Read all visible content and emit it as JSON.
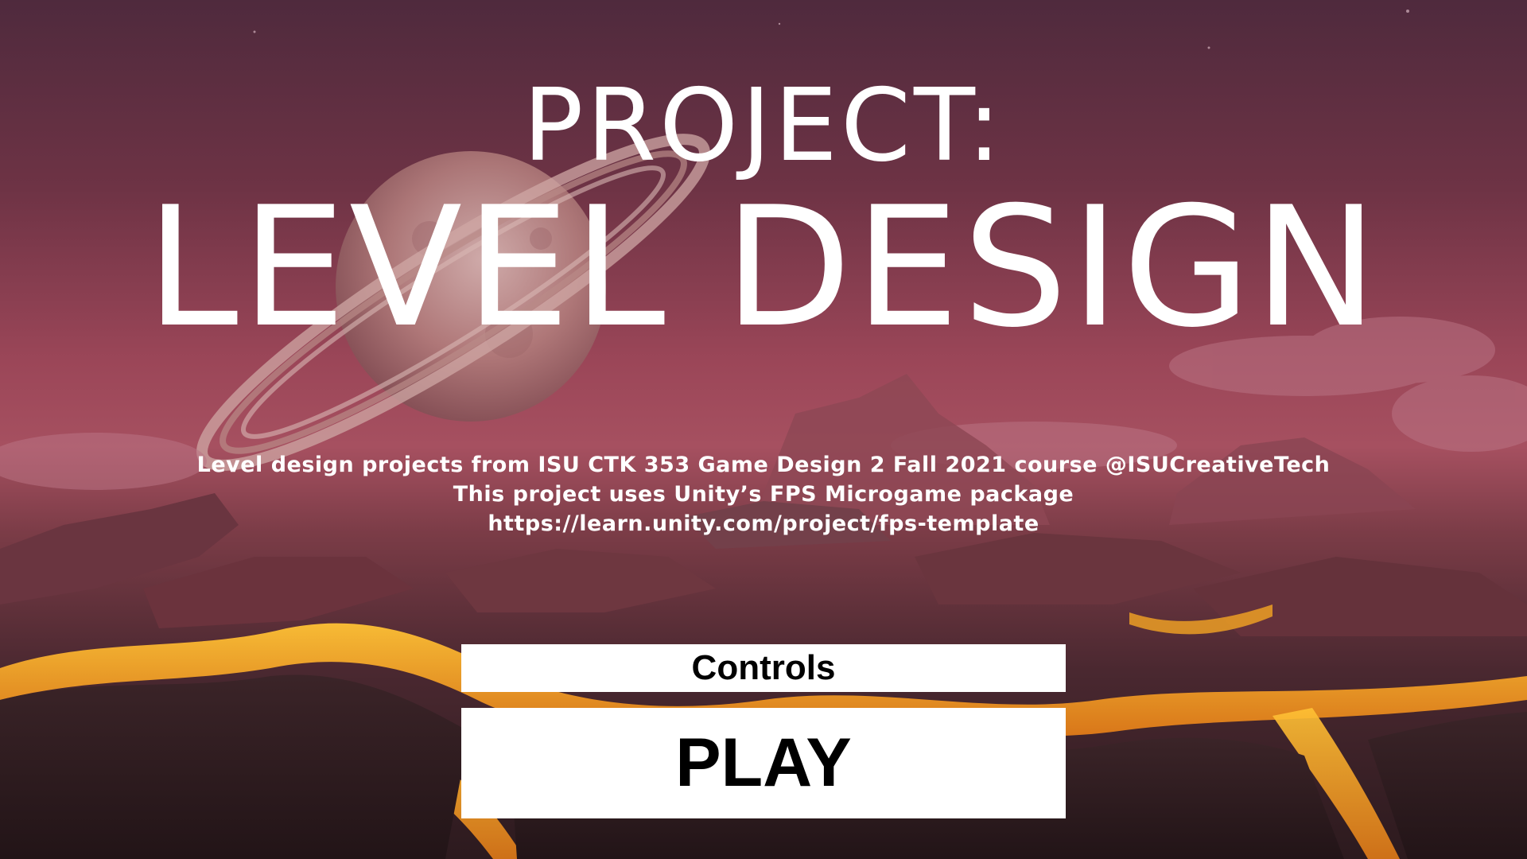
{
  "title": {
    "line1": "PROJECT:",
    "line2": "LEVEL DESIGN"
  },
  "credits": {
    "line1": "Level design projects from ISU CTK 353 Game Design 2 Fall 2021 course @ISUCreativeTech",
    "line2": "This project uses Unity’s FPS Microgame package",
    "line3": "https://learn.unity.com/project/fps-template"
  },
  "menu": {
    "controls_label": "Controls",
    "play_label": "PLAY"
  },
  "colors": {
    "sky_top": "#4f2a3d",
    "sky_mid": "#a65060",
    "rock": "#5e3038",
    "lava": "#f0a020",
    "button_bg": "#ffffff",
    "button_text": "#000000",
    "title_text": "#ffffff"
  },
  "background": {
    "scene": "alien-desert-landscape",
    "icons": [
      "ringed-planet-icon",
      "rock-formation-icon",
      "lava-river-icon",
      "cloud-icon"
    ]
  }
}
